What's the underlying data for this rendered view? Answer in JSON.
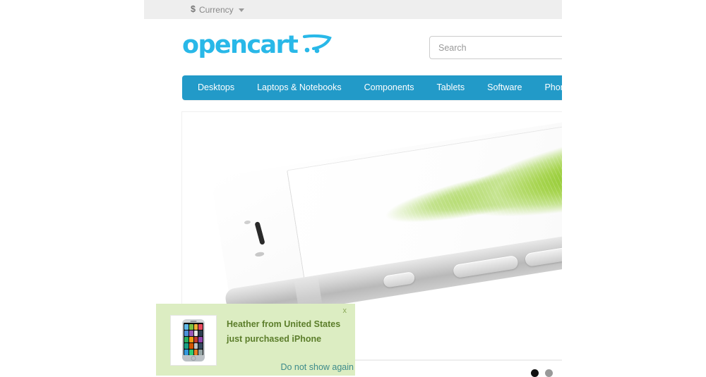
{
  "topbar": {
    "currency": {
      "symbol": "$",
      "label": "Currency"
    }
  },
  "header": {
    "logo_text": "opencart",
    "logo_icon": "shopping-cart-icon",
    "search": {
      "placeholder": "Search",
      "value": ""
    }
  },
  "nav": {
    "items": [
      {
        "label": "Desktops"
      },
      {
        "label": "Laptops & Notebooks"
      },
      {
        "label": "Components"
      },
      {
        "label": "Tablets"
      },
      {
        "label": "Software"
      },
      {
        "label": "Phones & PDAs"
      }
    ]
  },
  "banner": {
    "alt": "iPhone 6 product banner with green leaf on screen",
    "carousel": {
      "slides": 2,
      "active_index": 0
    }
  },
  "notification": {
    "line1": "Heather from United States",
    "line2": "just purchased iPhone",
    "close_label": "x",
    "dismiss_label": "Do not show again",
    "thumbnail_alt": "iPhone product thumbnail",
    "background_color": "#dcedc2",
    "text_color": "#5b7d2a",
    "link_color": "#3d8b8b"
  },
  "theme": {
    "nav_blue": "#229ac8",
    "logo_blue": "#29b8e8",
    "topbar_gray": "#eeeeee"
  }
}
